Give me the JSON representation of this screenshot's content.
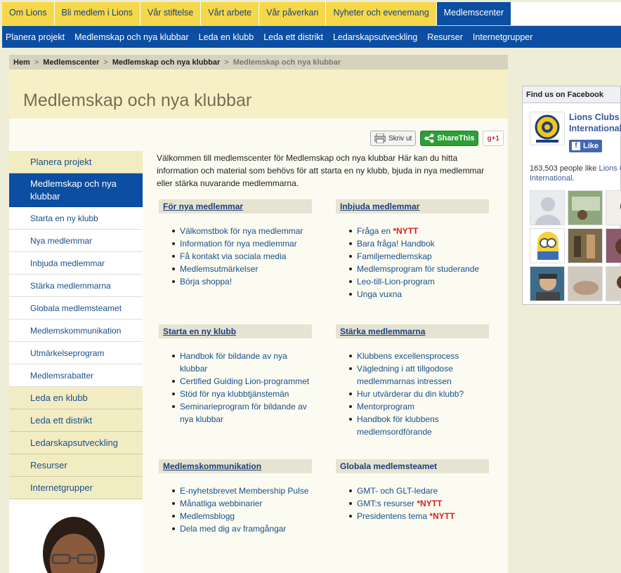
{
  "topnav": [
    "Om Lions",
    "Bli medlem i Lions",
    "Vår stiftelse",
    "Vårt arbete",
    "Vår påverkan",
    "Nyheter och evenemang",
    "Medlemscenter"
  ],
  "subnav": [
    "Planera projekt",
    "Medlemskap och nya klubbar",
    "Leda en klubb",
    "Leda ett distrikt",
    "Ledarskapsutveckling",
    "Resurser",
    "Internetgrupper"
  ],
  "breadcrumb": {
    "home": "Hem",
    "level1": "Medlemscenter",
    "level2": "Medlemskap och nya klubbar",
    "current": "Medlemskap och nya klubbar",
    "sep": ">"
  },
  "page_title": "Medlemskap och nya klubbar",
  "toolbar": {
    "print": "Skriv ut",
    "share": "ShareThis",
    "gplus": "g+1"
  },
  "sidenav": {
    "top": "Planera projekt",
    "active": "Medlemskap och nya klubbar",
    "sub": [
      "Starta en ny klubb",
      "Nya medlemmar",
      "Inbjuda medlemmar",
      "Stärka medlemmarna",
      "Globala medlemsteamet",
      "Medlemskommunikation",
      "Utmärkelseprogram",
      "Medlemsrabatter"
    ],
    "bottom": [
      "Leda en klubb",
      "Leda ett distrikt",
      "Ledarskapsutveckling",
      "Resurser",
      "Internetgrupper"
    ]
  },
  "intro": "Välkommen till medlemscenter för Medlemskap och nya klubbar Här kan du hitta information och material som behövs för att starta en ny klubb, bjuda in nya medlemmar eller stärka nuvarande medlemmarna.",
  "nytt": "*NYTT",
  "sections": {
    "s1": {
      "title": "För nya medlemmar",
      "items": [
        "Välkomstbok för nya medlemmar",
        "Information för nya medlemmar",
        "Få kontakt via sociala media",
        "Medlemsutmärkelser",
        "Börja shoppa!"
      ]
    },
    "s2": {
      "title": "Inbjuda medlemmar",
      "items": [
        "Fråga en",
        "Bara fråga! Handbok",
        "Familjemedlemskap",
        "Medlemsprogram för studerande",
        "Leo-till-Lion-program",
        "Unga vuxna"
      ]
    },
    "s3": {
      "title": "Starta en ny klubb",
      "items": [
        "Handbok för bildande av nya klubbar",
        "Certified Guiding Lion-programmet",
        "Stöd för nya klubbtjänstemän",
        "Seminarieprogram för bildande av nya klubbar"
      ]
    },
    "s4": {
      "title": "Stärka medlemmarna",
      "items": [
        "Klubbens excellensprocess",
        "Vägledning i att tillgodose medlemmarnas intressen",
        "Hur utvärderar du din klubb?",
        "Mentorprogram",
        "Handbok för klubbens medlemsordförande"
      ]
    },
    "s5": {
      "title": "Medlemskommunikation",
      "items": [
        "E-nyhetsbrevet Membership Pulse",
        "Månatliga webbinarier",
        "Medlemsblogg",
        "Dela med dig av framgångar"
      ]
    },
    "s6": {
      "title": "Globala medlemsteamet",
      "items": [
        "GMT- och GLT-ledare",
        "GMT:s resurser",
        "Presidentens tema"
      ]
    }
  },
  "facebook": {
    "heading": "Find us on Facebook",
    "page_name_1": "Lions Clubs",
    "page_name_2": "International",
    "like": "Like",
    "count_text": "163,503 people like",
    "count_link_1": "Lions Cl",
    "count_link_2": "International",
    "count_end": "."
  },
  "colors": {
    "brand_blue": "#0b4ea2",
    "brand_yellow": "#f5d84a",
    "nytt_red": "#d81f1f",
    "fb_blue": "#3b5998"
  }
}
